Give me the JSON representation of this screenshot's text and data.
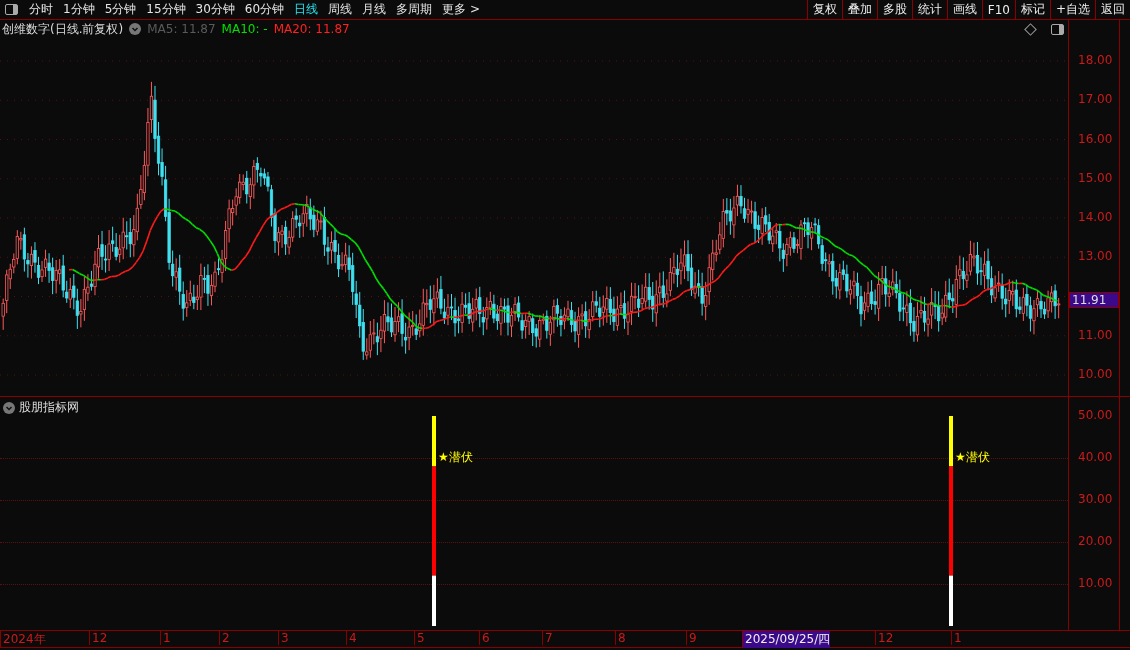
{
  "toolbar": {
    "periods": [
      {
        "label": "分时",
        "selected": false
      },
      {
        "label": "1分钟",
        "selected": false
      },
      {
        "label": "5分钟",
        "selected": false
      },
      {
        "label": "15分钟",
        "selected": false
      },
      {
        "label": "30分钟",
        "selected": false
      },
      {
        "label": "60分钟",
        "selected": false
      },
      {
        "label": "日线",
        "selected": true
      },
      {
        "label": "周线",
        "selected": false
      },
      {
        "label": "月线",
        "selected": false
      },
      {
        "label": "多周期",
        "selected": false
      }
    ],
    "more": {
      "label": "更多",
      "arrow": ">"
    },
    "buttons": [
      "复权",
      "叠加",
      "多股",
      "统计",
      "画线",
      "F10",
      "标记",
      "+自选",
      "返回"
    ]
  },
  "price_panel": {
    "title": "创维数字(日线.前复权)",
    "legend": [
      {
        "label": "MA5: 11.87",
        "color": "#5a5a5a"
      },
      {
        "label": "MA10: -",
        "color": "#00e000"
      },
      {
        "label": "MA20: 11.87",
        "color": "#ff2020"
      }
    ],
    "axis_ticks": [
      "18.00",
      "17.00",
      "16.00",
      "15.00",
      "14.00",
      "13.00",
      "11.00",
      "10.00"
    ],
    "current_price": "11.91"
  },
  "indicator_panel": {
    "title": "股朋指标网",
    "axis_ticks": [
      "50.00",
      "40.00",
      "30.00",
      "20.00",
      "10.00"
    ],
    "signals": [
      {
        "label": "★潜伏"
      },
      {
        "label": "★潜伏"
      }
    ]
  },
  "date_axis": [
    {
      "label": "2024年",
      "selected": false
    },
    {
      "label": "12",
      "selected": false
    },
    {
      "label": "1",
      "selected": false
    },
    {
      "label": "2",
      "selected": false
    },
    {
      "label": "3",
      "selected": false
    },
    {
      "label": "4",
      "selected": false
    },
    {
      "label": "5",
      "selected": false
    },
    {
      "label": "6",
      "selected": false
    },
    {
      "label": "7",
      "selected": false
    },
    {
      "label": "8",
      "selected": false
    },
    {
      "label": "9",
      "selected": false
    },
    {
      "label": "2025/09/25/四",
      "selected": true
    },
    {
      "label": "12",
      "selected": false
    },
    {
      "label": "1",
      "selected": false
    }
  ]
}
